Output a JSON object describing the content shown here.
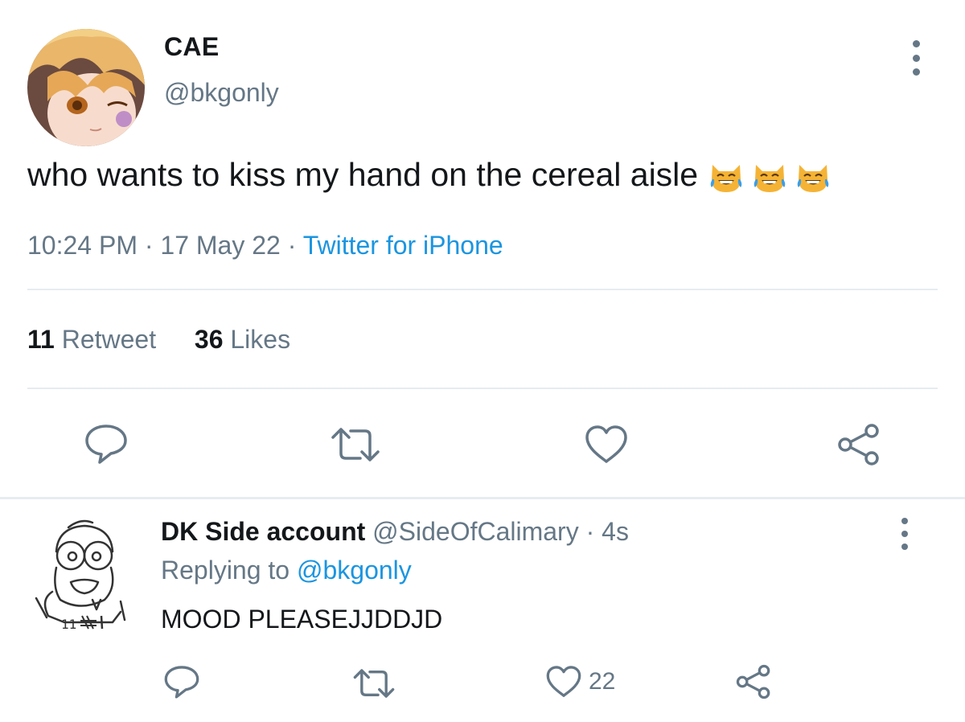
{
  "tweet": {
    "display_name": "CAE",
    "handle": "@bkgonly",
    "text": "who wants to kiss my hand on the cereal aisle",
    "emojis": [
      "laughing-cat-emoji",
      "laughing-cat-emoji",
      "laughing-cat-emoji"
    ],
    "time": "10:24 PM",
    "date": "17 May 22",
    "separator": "·",
    "source": "Twitter for iPhone",
    "retweet_count": "11",
    "retweet_label": "Retweet",
    "like_count": "36",
    "like_label": "Likes"
  },
  "reply": {
    "display_name": "DK Side account",
    "handle": "@SideOfCalimary",
    "separator": "·",
    "time": "4s",
    "replying_label": "Replying to",
    "replying_handle": "@bkgonly",
    "text": "MOOD PLEASEJJDDJD",
    "like_count": "22"
  },
  "icons": {
    "reply": "reply-bubble-icon",
    "retweet": "retweet-icon",
    "like": "heart-icon",
    "share": "share-icon",
    "more": "more-vertical-icon"
  },
  "colors": {
    "text_primary": "#14171a",
    "text_secondary": "#657786",
    "link": "#1b95e0",
    "divider": "#e6ecf0"
  }
}
